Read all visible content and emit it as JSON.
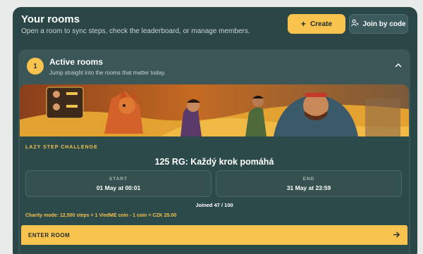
{
  "header": {
    "title": "Your rooms",
    "subtitle": "Open a room to sync steps, check the leaderboard, or manage members.",
    "create_label": "Create",
    "join_label": "Join by code"
  },
  "section": {
    "step_number": "1",
    "title": "Active rooms",
    "subtitle": "Jump straight into the rooms that matter today."
  },
  "room": {
    "eyebrow": "LAZY STEP CHALLENGE",
    "title": "125 RG: Každý krok pomáhá",
    "start_label": "START",
    "start_value": "01 May at 00:01",
    "end_label": "END",
    "end_value": "31 May at 23:59",
    "joined": "Joined 47 / 100",
    "charity": "Charity mode: 12,500 steps = 1 ViedME coin - 1 coin = CZK 25.00",
    "enter_label": "ENTER ROOM"
  },
  "colors": {
    "accent": "#f8c44d",
    "background": "#2b4647",
    "panel": "#3b5656"
  },
  "icons": {
    "create": "plus-icon",
    "join": "person-key-icon",
    "collapse": "chevron-up-icon",
    "enter": "arrow-right-icon"
  }
}
